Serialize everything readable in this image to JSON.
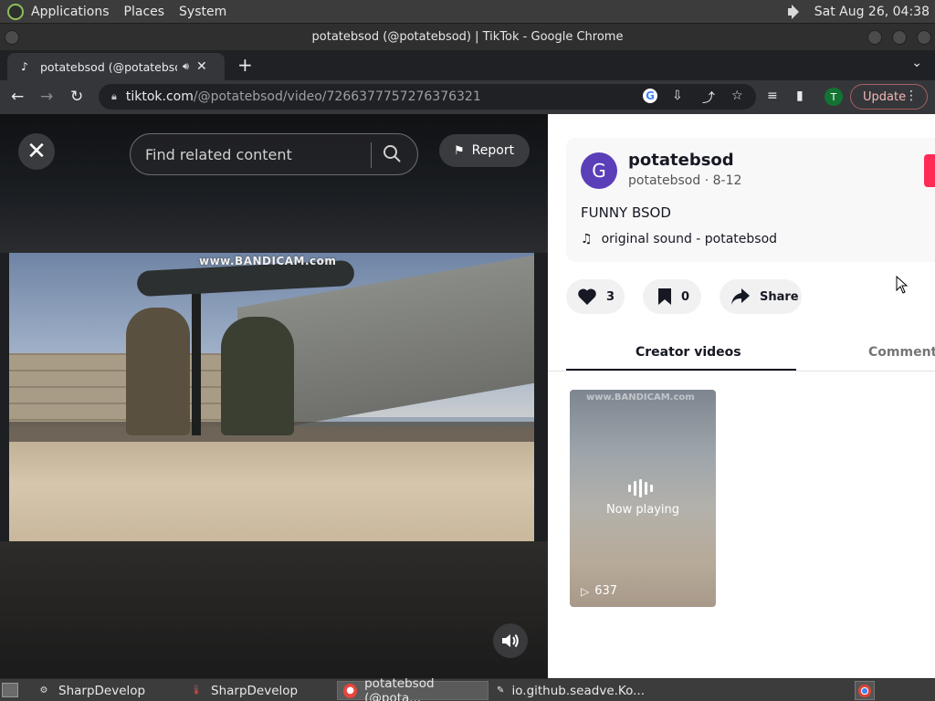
{
  "top_panel": {
    "menus": [
      "Applications",
      "Places",
      "System"
    ],
    "clock": "Sat Aug 26, 04:38"
  },
  "window": {
    "title": "potatebsod (@potatebsod) | TikTok - Google Chrome"
  },
  "browser": {
    "tab_title": "potatebsod (@potatebsod",
    "url_host": "tiktok.com",
    "url_path": "/@potatebsod/video/7266377757276376321",
    "profile_initial": "T",
    "update_label": "Update"
  },
  "video": {
    "search_placeholder": "Find related content",
    "report_label": "Report",
    "watermark": "www.BANDICAM.com"
  },
  "details": {
    "avatar_initial": "G",
    "author_name": "potatebsod",
    "author_handle": "potatebsod",
    "post_date": "8-12",
    "caption": "FUNNY BSOD",
    "sound": "original sound - potatebsod",
    "likes": "3",
    "saves": "0",
    "share_label": "Share",
    "tabs": [
      "Creator videos",
      "Comments"
    ],
    "thumbnail": {
      "status": "Now playing",
      "plays": "637",
      "watermark": "www.BANDICAM.com"
    }
  },
  "taskbar": {
    "tasks": [
      "SharpDevelop",
      "SharpDevelop",
      "potatebsod (@pota...",
      "io.github.seadve.Ko..."
    ]
  },
  "colors": {
    "tiktok_red": "#fe2c55",
    "avatar_purple": "#5b3fb8",
    "chrome_dark": "#35363a"
  }
}
